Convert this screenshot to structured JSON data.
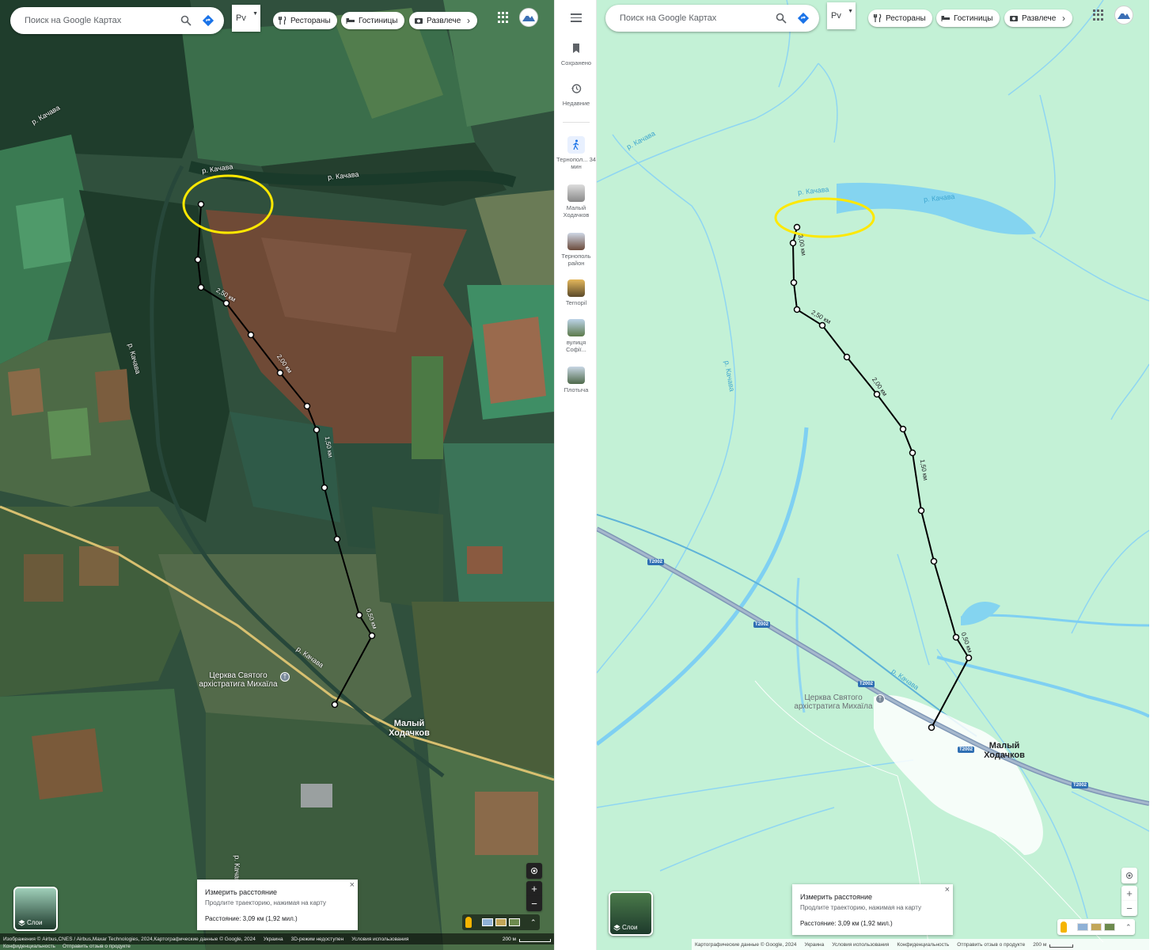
{
  "search": {
    "placeholder": "Поиск на Google Картах"
  },
  "route_dropdown": {
    "label": "Рv"
  },
  "chips": [
    "Рестораны",
    "Гостиницы",
    "Развлече"
  ],
  "sidebar": {
    "saved": "Сохранено",
    "recent": "Недавние",
    "items": [
      {
        "label": "Тернопол... 34 мин"
      },
      {
        "label": "Малый Ходачков"
      },
      {
        "label": "Тернополь район"
      },
      {
        "label": "Ternopil"
      },
      {
        "label": "вулиця Софії..."
      },
      {
        "label": "Плотыча"
      }
    ]
  },
  "labels": {
    "river": "р. Качава",
    "church": "Церква Святого архістратига Михаїла",
    "town": "Малый Ходачков",
    "road": "T2002",
    "dist_left": [
      "2,50 км",
      "2,00 км",
      "1,50 км",
      "0,50 км"
    ],
    "dist_right": [
      "3,00 км",
      "2,50 км",
      "2,00 км",
      "1,50 км",
      "0,50 км"
    ]
  },
  "measure": {
    "title": "Измерить расстояние",
    "hint": "Продлите траекторию, нажимая на карту",
    "distance": "Расстояние: 3,09 км (1,92 мил.)"
  },
  "layers_label": "Слои",
  "footer_left": {
    "attribution": "Изображения © Airbus,CNES / Airbus,Maxar Technologies, 2024,Картографические данные © Google, 2024",
    "country": "Украина",
    "mode": "3D-режим недоступен",
    "terms": "Условия использования",
    "privacy": "Конфиденциальность",
    "feedback": "Отправить отзыв о продукте",
    "scale": "200 м"
  },
  "footer_right": {
    "attribution": "Картографические данные © Google, 2024",
    "country": "Украина",
    "terms": "Условия использования",
    "privacy": "Конфиденциальность",
    "feedback": "Отправить отзыв о продукте",
    "scale": "200 м"
  },
  "colors": {
    "highlight": "#ffe800",
    "water": "#84d4f0",
    "map_bg": "#c3f1d6",
    "road": "#7f97b6"
  },
  "icons": [
    "search-icon",
    "directions-icon",
    "restaurant-icon",
    "hotel-icon",
    "camera-icon",
    "apps-icon",
    "menu-icon",
    "bookmark-icon",
    "history-icon",
    "walk-icon",
    "layers-icon",
    "location-icon",
    "zoom-in-icon",
    "zoom-out-icon",
    "pegman-icon",
    "close-icon"
  ]
}
